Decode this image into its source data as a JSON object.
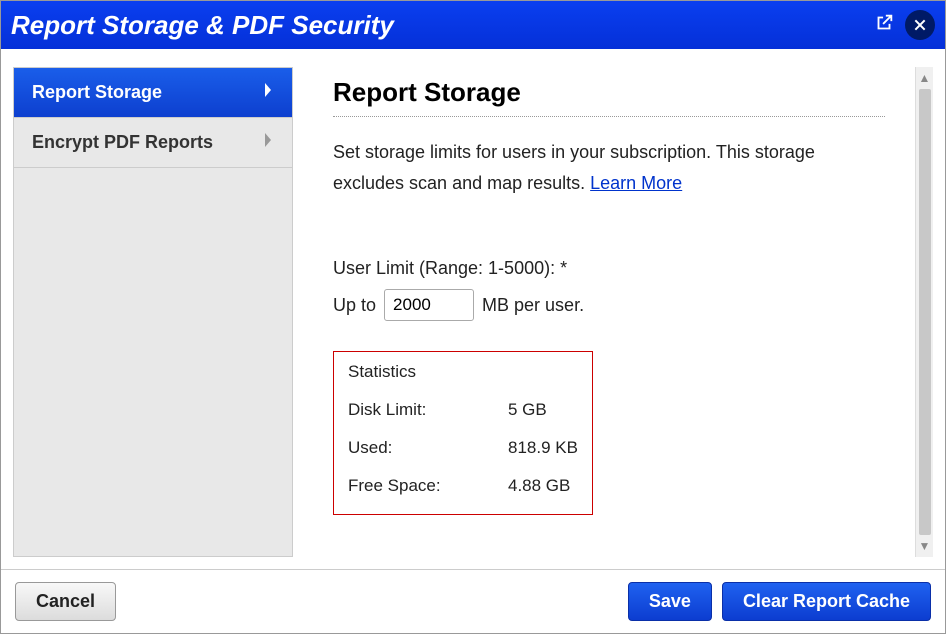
{
  "window": {
    "title": "Report Storage & PDF Security"
  },
  "sidebar": {
    "items": [
      {
        "label": "Report Storage",
        "active": true
      },
      {
        "label": "Encrypt PDF Reports",
        "active": false
      }
    ]
  },
  "main": {
    "heading": "Report Storage",
    "description_part1": "Set storage limits for users in your subscription. This storage excludes scan and map results. ",
    "learn_more": "Learn More",
    "user_limit_label": "User Limit (Range: 1-5000): *",
    "up_to": "Up to",
    "user_limit_value": "2000",
    "mb_per_user": "MB per user.",
    "stats": {
      "title": "Statistics",
      "rows": [
        {
          "label": "Disk Limit:",
          "value": "5 GB"
        },
        {
          "label": "Used:",
          "value": "818.9 KB"
        },
        {
          "label": "Free Space:",
          "value": "4.88 GB"
        }
      ]
    }
  },
  "footer": {
    "cancel": "Cancel",
    "save": "Save",
    "clear_cache": "Clear Report Cache"
  }
}
